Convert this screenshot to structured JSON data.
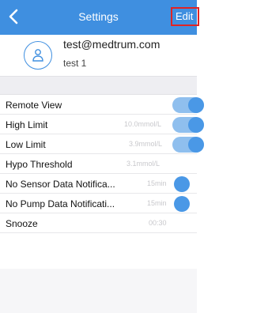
{
  "header": {
    "title": "Settings",
    "edit_label": "Edit"
  },
  "profile": {
    "email": "test@medtrum.com",
    "name": "test 1"
  },
  "settings": [
    {
      "label": "Remote View",
      "value": "",
      "toggle": "on"
    },
    {
      "label": "High Limit",
      "value": "10.0mmol/L",
      "toggle": "on"
    },
    {
      "label": "Low Limit",
      "value": "3.9mmol/L",
      "toggle": "on"
    },
    {
      "label": "Hypo Threshold",
      "value": "3.1mmol/L",
      "toggle": "none"
    },
    {
      "label": "No Sensor Data Notifica...",
      "value": "15min",
      "toggle": "off"
    },
    {
      "label": "No Pump Data Notificati...",
      "value": "15min",
      "toggle": "off"
    },
    {
      "label": "Snooze",
      "value": "00:30",
      "toggle": "none"
    }
  ],
  "colors": {
    "nav_bar": "#3f8fe0",
    "accent": "#4a98e6",
    "edit_highlight": "#e02424"
  },
  "icons": {
    "back": "chevron-left-icon",
    "avatar": "user-icon"
  }
}
